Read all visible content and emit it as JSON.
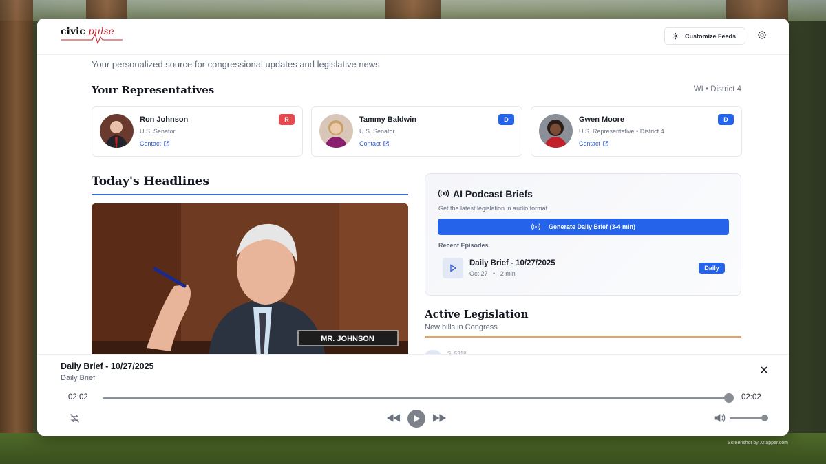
{
  "app": {
    "logo_civic": "civic",
    "logo_pulse": "pulse",
    "customize_label": "Customize Feeds",
    "subtitle": "Your personalized source for congressional updates and legislative news"
  },
  "representatives": {
    "heading": "Your Representatives",
    "district": "WI • District 4",
    "items": [
      {
        "name": "Ron Johnson",
        "title": "U.S. Senator",
        "party": "R",
        "party_color": "#e5484d",
        "contact": "Contact"
      },
      {
        "name": "Tammy Baldwin",
        "title": "U.S. Senator",
        "party": "D",
        "party_color": "#2563eb",
        "contact": "Contact"
      },
      {
        "name": "Gwen Moore",
        "title": "U.S. Representative • District 4",
        "party": "D",
        "party_color": "#2563eb",
        "contact": "Contact"
      }
    ]
  },
  "headlines": {
    "heading": "Today's Headlines",
    "nameplate": "MR. JOHNSON"
  },
  "podcast": {
    "title": "AI Podcast Briefs",
    "subtitle": "Get the latest legislation in audio format",
    "generate_label": "Generate Daily Brief (3-4 min)",
    "recent_label": "Recent Episodes",
    "episode": {
      "title": "Daily Brief - 10/27/2025",
      "date": "Oct 27",
      "duration": "2 min",
      "badge": "Daily"
    }
  },
  "legislation": {
    "heading": "Active Legislation",
    "subtitle": "New bills in Congress",
    "partial_item": "S. 5318"
  },
  "player": {
    "title": "Daily Brief - 10/27/2025",
    "subtitle": "Daily Brief",
    "time_elapsed": "02:02",
    "time_total": "02:02",
    "progress": 1.0,
    "volume": 1.0
  },
  "credit": "Screenshot by Xnapper.com"
}
